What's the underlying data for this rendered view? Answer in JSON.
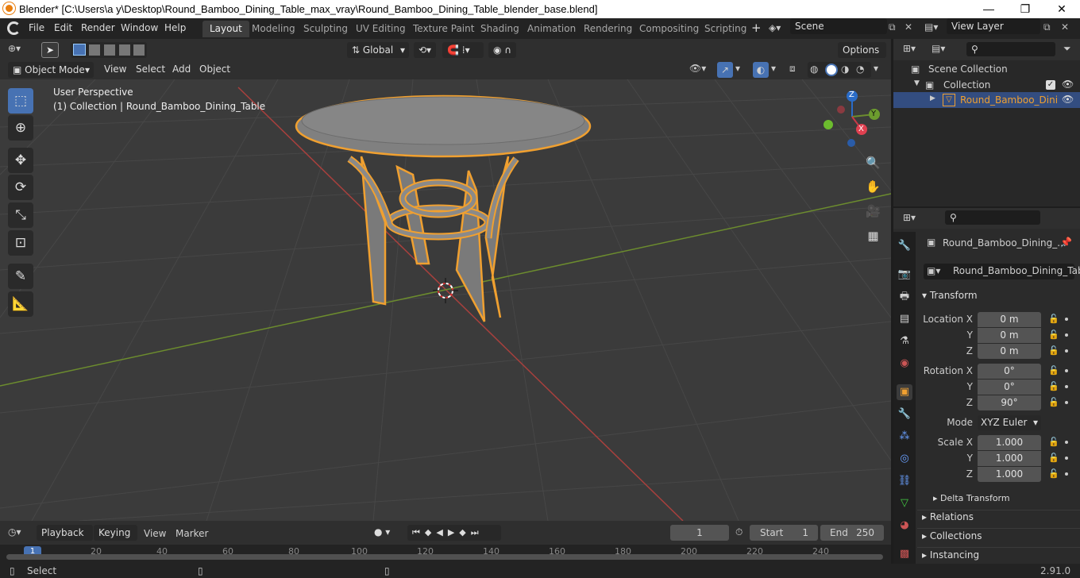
{
  "window": {
    "title": "Blender* [C:\\Users\\a y\\Desktop\\Round_Bamboo_Dining_Table_max_vray\\Round_Bamboo_Dining_Table_blender_base.blend]",
    "controls": [
      "—",
      "❐",
      "✕"
    ]
  },
  "menubar": [
    "File",
    "Edit",
    "Render",
    "Window",
    "Help"
  ],
  "workspaces": [
    "Layout",
    "Modeling",
    "Sculpting",
    "UV Editing",
    "Texture Paint",
    "Shading",
    "Animation",
    "Rendering",
    "Compositing",
    "Scripting"
  ],
  "active_workspace": "Layout",
  "scene": {
    "name": "Scene",
    "view_layer": "View Layer"
  },
  "viewport_header": {
    "transform_orientation": "Global",
    "options_label": "Options",
    "mode": "Object Mode",
    "menus": [
      "View",
      "Select",
      "Add",
      "Object"
    ]
  },
  "viewport": {
    "perspective_label": "User Perspective",
    "collection_label": "(1) Collection | Round_Bamboo_Dining_Table",
    "gizmo": {
      "x": "X",
      "y": "Y",
      "z": "Z"
    }
  },
  "tools": [
    "select-box",
    "cursor",
    "move",
    "rotate",
    "scale",
    "transform",
    "annotate",
    "measure"
  ],
  "outliner": {
    "root": "Scene Collection",
    "collection": "Collection",
    "object": "Round_Bamboo_Dini"
  },
  "properties": {
    "object_name": "Round_Bamboo_Dining_...",
    "object_field": "Round_Bamboo_Dining_Table",
    "transform_label": "Transform",
    "location": {
      "label": "Location X",
      "y_label": "Y",
      "z_label": "Z",
      "x": "0 m",
      "y": "0 m",
      "z": "0 m"
    },
    "rotation": {
      "label": "Rotation X",
      "y_label": "Y",
      "z_label": "Z",
      "x": "0°",
      "y": "0°",
      "z": "90°"
    },
    "mode_label": "Mode",
    "mode_value": "XYZ Euler",
    "scale": {
      "label": "Scale X",
      "y_label": "Y",
      "z_label": "Z",
      "x": "1.000",
      "y": "1.000",
      "z": "1.000"
    },
    "delta_label": "Delta Transform",
    "sections": [
      "Relations",
      "Collections",
      "Instancing"
    ]
  },
  "timeline": {
    "menus": [
      "Playback",
      "Keying",
      "View",
      "Marker"
    ],
    "current_frame": "1",
    "start_label": "Start",
    "start": "1",
    "end_label": "End",
    "end": "250",
    "ruler": [
      "1",
      "20",
      "40",
      "60",
      "80",
      "100",
      "120",
      "140",
      "160",
      "180",
      "200",
      "220",
      "240"
    ]
  },
  "statusbar": {
    "left": "Select",
    "version": "2.91.0"
  },
  "colors": {
    "accent": "#4772b3",
    "selection": "#f0a030",
    "x_axis": "#a8403d",
    "y_axis": "#6c8c2e"
  }
}
